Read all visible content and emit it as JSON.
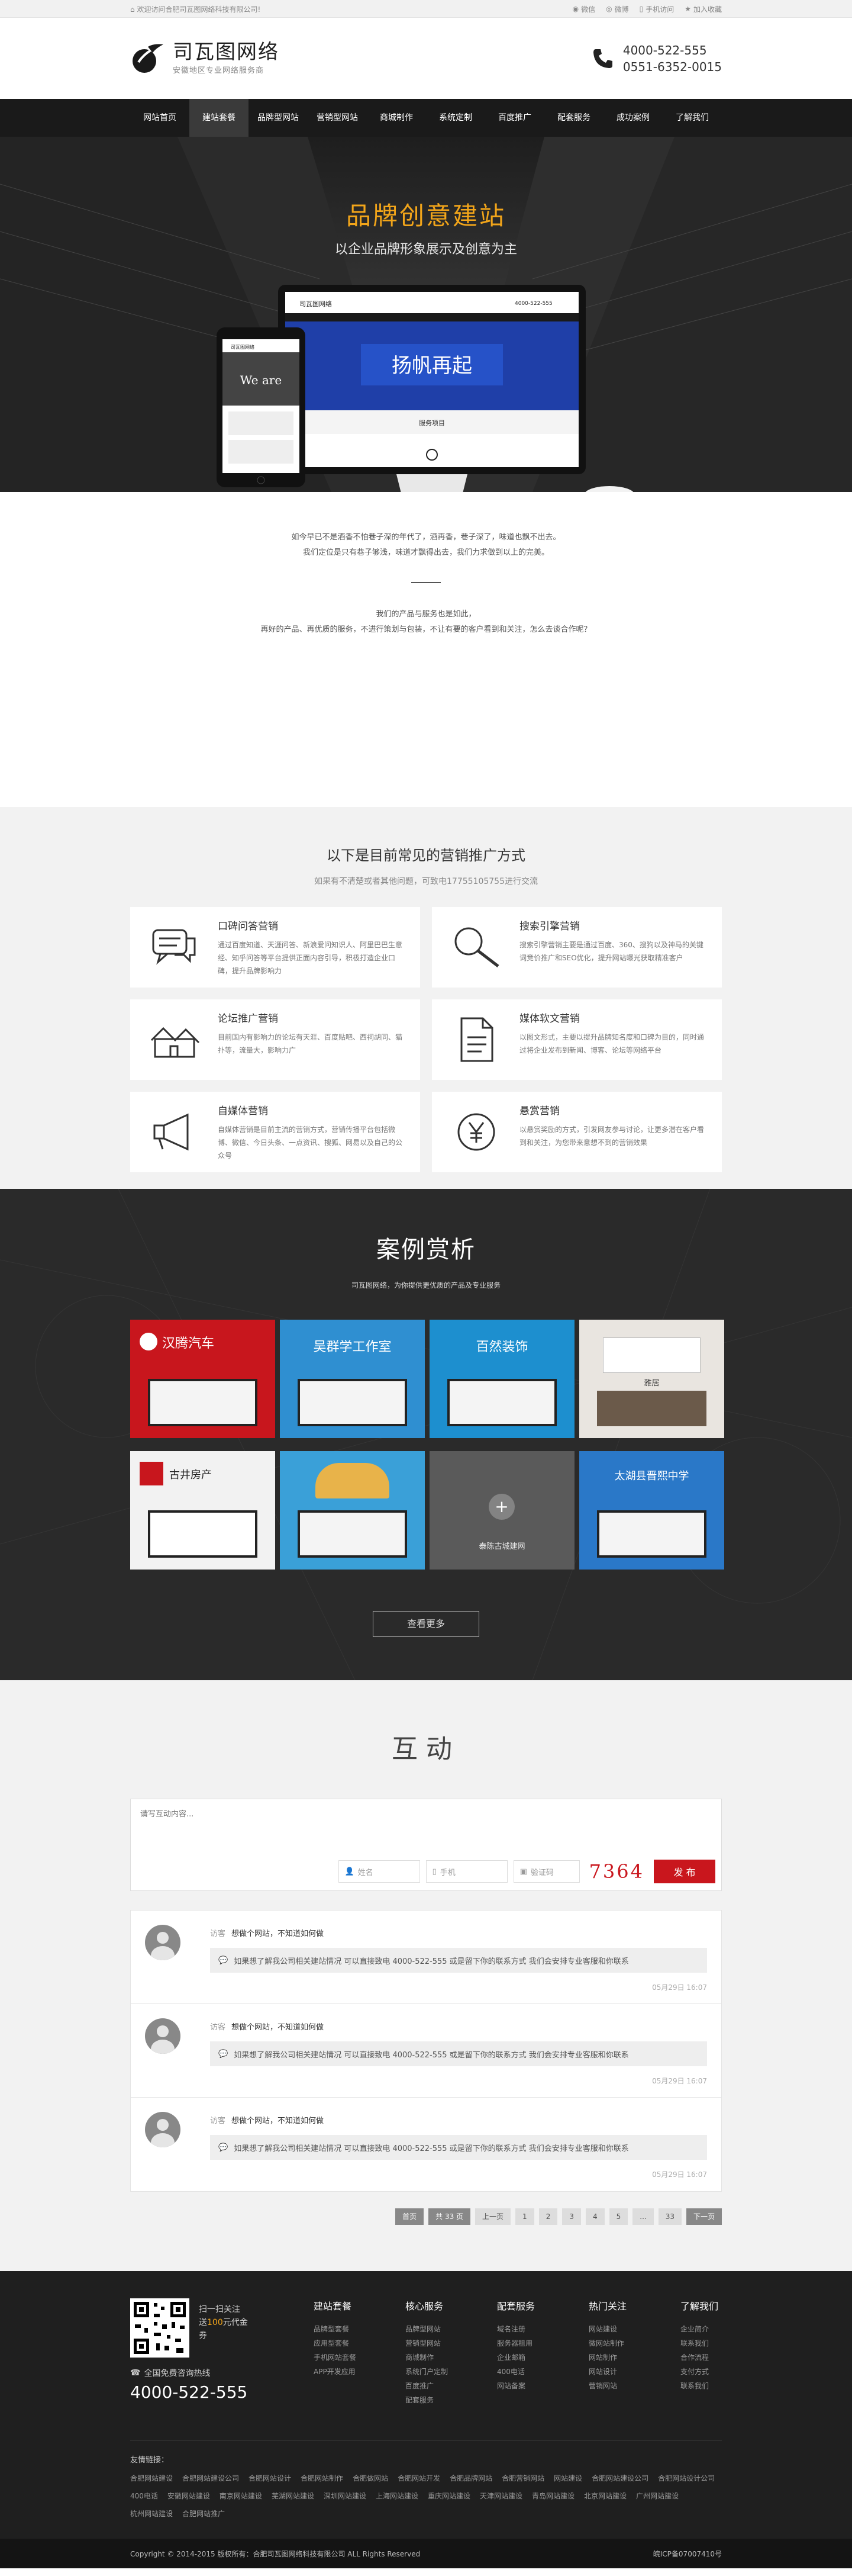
{
  "topbar": {
    "welcome": "欢迎访问合肥司瓦图网络科技有限公司!",
    "links": [
      "微信",
      "微博",
      "手机访问",
      "加入收藏"
    ]
  },
  "header": {
    "logo_name": "司瓦图网络",
    "logo_slogan": "安徽地区专业网络服务商",
    "phones": [
      "4000-522-555",
      "0551-6352-0015"
    ]
  },
  "nav": {
    "items": [
      "网站首页",
      "建站套餐",
      "品牌型网站",
      "营销型网站",
      "商城制作",
      "系统定制",
      "百度推广",
      "配套服务",
      "成功案例",
      "了解我们"
    ],
    "active_index": 1
  },
  "hero": {
    "title": "品牌创意建站",
    "subtitle": "以企业品牌形象展示及创意为主",
    "mockup_logo": "司瓦图网络",
    "mockup_phone": "4000-522-555",
    "mockup_banner_text": "扬帆再起",
    "mockup_service": "服务项目",
    "mockup_tablet_logo": "司瓦图网络",
    "mockup_tablet_text": "We are"
  },
  "intro": {
    "lines1": [
      "如今早已不是酒香不怕巷子深的年代了，酒再香，巷子深了，味道也飘不出去。",
      "我们定位是只有巷子够浅，味道才飘得出去，我们力求做到以上的完美。"
    ],
    "lines2": [
      "我们的产品与服务也是如此，",
      "再好的产品、再优质的服务，不进行策划与包装，不让有要的客户看到和关注，怎么去谈合作呢？"
    ]
  },
  "marketing": {
    "title": "以下是目前常见的营销推广方式",
    "subtitle": "如果有不清楚或者其他问题，可致电17755105755进行交流",
    "cards": [
      {
        "icon": "chat-bubbles-icon",
        "title": "口碑问答营销",
        "desc": "通过百度知道、天涯问答、新浪爱问知识人、阿里巴巴生意经、知乎问答等平台提供正面内容引导，积极打造企业口碑，提升品牌影响力"
      },
      {
        "icon": "magnifier-icon",
        "title": "搜索引擎营销",
        "desc": "搜索引擎营销主要是通过百度、360、搜狗以及神马的关键词竞价推广和SEO优化，提升网站曝光获取精准客户"
      },
      {
        "icon": "house-icon",
        "title": "论坛推广营销",
        "desc": "目前国内有影响力的论坛有天涯、百度贴吧、西祠胡同、猫扑等，流量大，影响力广"
      },
      {
        "icon": "document-icon",
        "title": "媒体软文营销",
        "desc": "以图文形式，主要以提升品牌知名度和口碑为目的，同时通过将企业发布到新闻、博客、论坛等网络平台"
      },
      {
        "icon": "megaphone-icon",
        "title": "自媒体营销",
        "desc": "自媒体营销是目前主流的营销方式，营销传播平台包括微博、微信、今日头条、一点资讯、搜狐、网易以及自己的公众号"
      },
      {
        "icon": "yuan-coin-icon",
        "title": "悬赏营销",
        "desc": "以悬赏奖励的方式，引发网友参与讨论，让更多潜在客户看到和关注，为您带来意想不到的营销效果"
      }
    ]
  },
  "cases": {
    "title": "案例赏析",
    "subtitle": "司瓦图网络，为你提供更优质的产品及专业服务",
    "items": [
      {
        "label": "汉腾汽车",
        "bg": "#c8161d"
      },
      {
        "label": "吴群学工作室",
        "bg": "#2f8fd1"
      },
      {
        "label": "百然装饰",
        "bg": "#1d8fcf"
      },
      {
        "label": "雅居",
        "bg": "#e9e5e0"
      },
      {
        "label": "古井房产",
        "bg": "#f2f2f2"
      },
      {
        "label": "",
        "bg": "#3aa0d8"
      },
      {
        "label": "泰陈古城建网",
        "bg": "#5a5a5a"
      },
      {
        "label": "太湖县晋熙中学",
        "bg": "#2a78c8"
      }
    ],
    "more": "查看更多"
  },
  "interact": {
    "title": "互动",
    "placeholder": "请写互动内容...",
    "name_ph": "姓名",
    "phone_ph": "手机",
    "code_ph": "验证码",
    "captcha": "7364",
    "publish": "发 布",
    "comments": [
      {
        "label": "访客",
        "text": "想做个网站，不知道如何做",
        "reply": "如果想了解我公司相关建站情况 可以直接致电 4000-522-555 或是留下你的联系方式 我们会安排专业客服和你联系",
        "time": "05月29日 16:07"
      },
      {
        "label": "访客",
        "text": "想做个网站，不知道如何做",
        "reply": "如果想了解我公司相关建站情况 可以直接致电 4000-522-555 或是留下你的联系方式 我们会安排专业客服和你联系",
        "time": "05月29日 16:07"
      },
      {
        "label": "访客",
        "text": "想做个网站，不知道如何做",
        "reply": "如果想了解我公司相关建站情况 可以直接致电 4000-522-555 或是留下你的联系方式 我们会安排专业客服和你联系",
        "time": "05月29日 16:07"
      }
    ],
    "pager": [
      "首页",
      "共 33 页",
      "上一页",
      "1",
      "2",
      "3",
      "4",
      "5",
      "...",
      "33",
      "下一页"
    ]
  },
  "footer": {
    "qr_line1": "扫一扫关注",
    "qr_line2a": "送",
    "qr_line2b": "100",
    "qr_line2c": "元代金",
    "qr_line3": "券",
    "phone_label": "全国免费咨询热线",
    "phone": "4000-522-555",
    "cols": [
      {
        "title": "建站套餐",
        "items": [
          "品牌型套餐",
          "应用型套餐",
          "手机网站套餐",
          "APP开发应用"
        ]
      },
      {
        "title": "核心服务",
        "items": [
          "品牌型网站",
          "营销型网站",
          "商城制作",
          "系统门户定制",
          "百度推广",
          "配套服务"
        ]
      },
      {
        "title": "配套服务",
        "items": [
          "域名注册",
          "服务器租用",
          "企业邮箱",
          "400电话",
          "网站备案"
        ]
      },
      {
        "title": "热门关注",
        "items": [
          "网站建设",
          "微网站制作",
          "网站制作",
          "网站设计",
          "营销网站"
        ]
      },
      {
        "title": "了解我们",
        "items": [
          "企业简介",
          "联系我们",
          "合作流程",
          "支付方式",
          "联系我们"
        ]
      }
    ],
    "friend_title": "友情链接：",
    "friend_links": [
      "合肥网站建设",
      "合肥网站建设公司",
      "合肥网站设计",
      "合肥网站制作",
      "合肥做网站",
      "合肥网站开发",
      "合肥品牌网站",
      "合肥营销网站",
      "网站建设",
      "合肥网站建设公司",
      "合肥网站设计公司",
      "400电话",
      "安徽网站建设",
      "南京网站建设",
      "芜湖网站建设",
      "深圳网站建设",
      "上海网站建设",
      "重庆网站建设",
      "天津网站建设",
      "青岛网站建设",
      "北京网站建设",
      "广州网站建设",
      "杭州网站建设",
      "合肥网站推广"
    ],
    "copyright": "Copyright © 2014-2015 版权所有：合肥司瓦图网络科技有限公司  ALL Rights Reserved",
    "icp": "皖ICP备07007410号"
  },
  "colors": {
    "accent": "#f2a51a",
    "nav": "#1a1a1a",
    "publish": "#c9161d"
  }
}
